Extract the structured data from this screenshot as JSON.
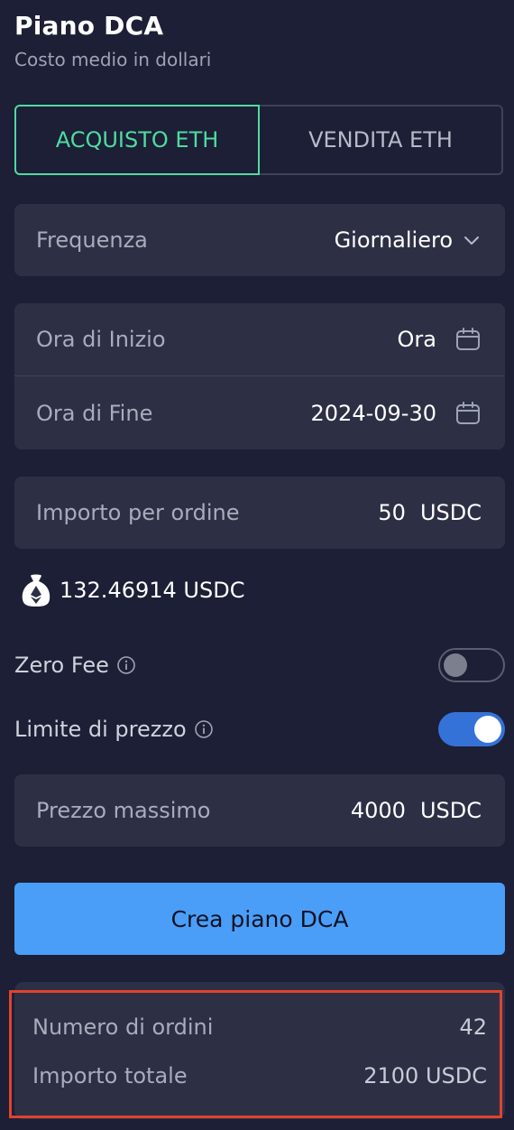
{
  "header": {
    "title": "Piano DCA",
    "subtitle": "Costo medio in dollari"
  },
  "tabs": [
    {
      "label": "ACQUISTO ETH",
      "active": true
    },
    {
      "label": "VENDITA ETH",
      "active": false
    }
  ],
  "frequency": {
    "label": "Frequenza",
    "value": "Giornaliero"
  },
  "schedule": {
    "start": {
      "label": "Ora di Inizio",
      "value": "Ora"
    },
    "end": {
      "label": "Ora di Fine",
      "value": "2024-09-30"
    }
  },
  "amount": {
    "label": "Importo per ordine",
    "value": "50",
    "unit": "USDC"
  },
  "balance": {
    "value": "132.46914 USDC"
  },
  "zero_fee": {
    "label": "Zero Fee",
    "enabled": false
  },
  "price_limit": {
    "label": "Limite di prezzo",
    "enabled": true
  },
  "max_price": {
    "label": "Prezzo massimo",
    "value": "4000",
    "unit": "USDC"
  },
  "cta": {
    "label": "Crea piano DCA"
  },
  "summary": {
    "orders": {
      "label": "Numero di ordini",
      "value": "42"
    },
    "total": {
      "label": "Importo totale",
      "value": "2100 USDC"
    }
  },
  "colors": {
    "accent": "#4fdba0",
    "primary_button": "#4a9ef7",
    "toggle_on": "#3572d8",
    "highlight": "#e0432f"
  }
}
